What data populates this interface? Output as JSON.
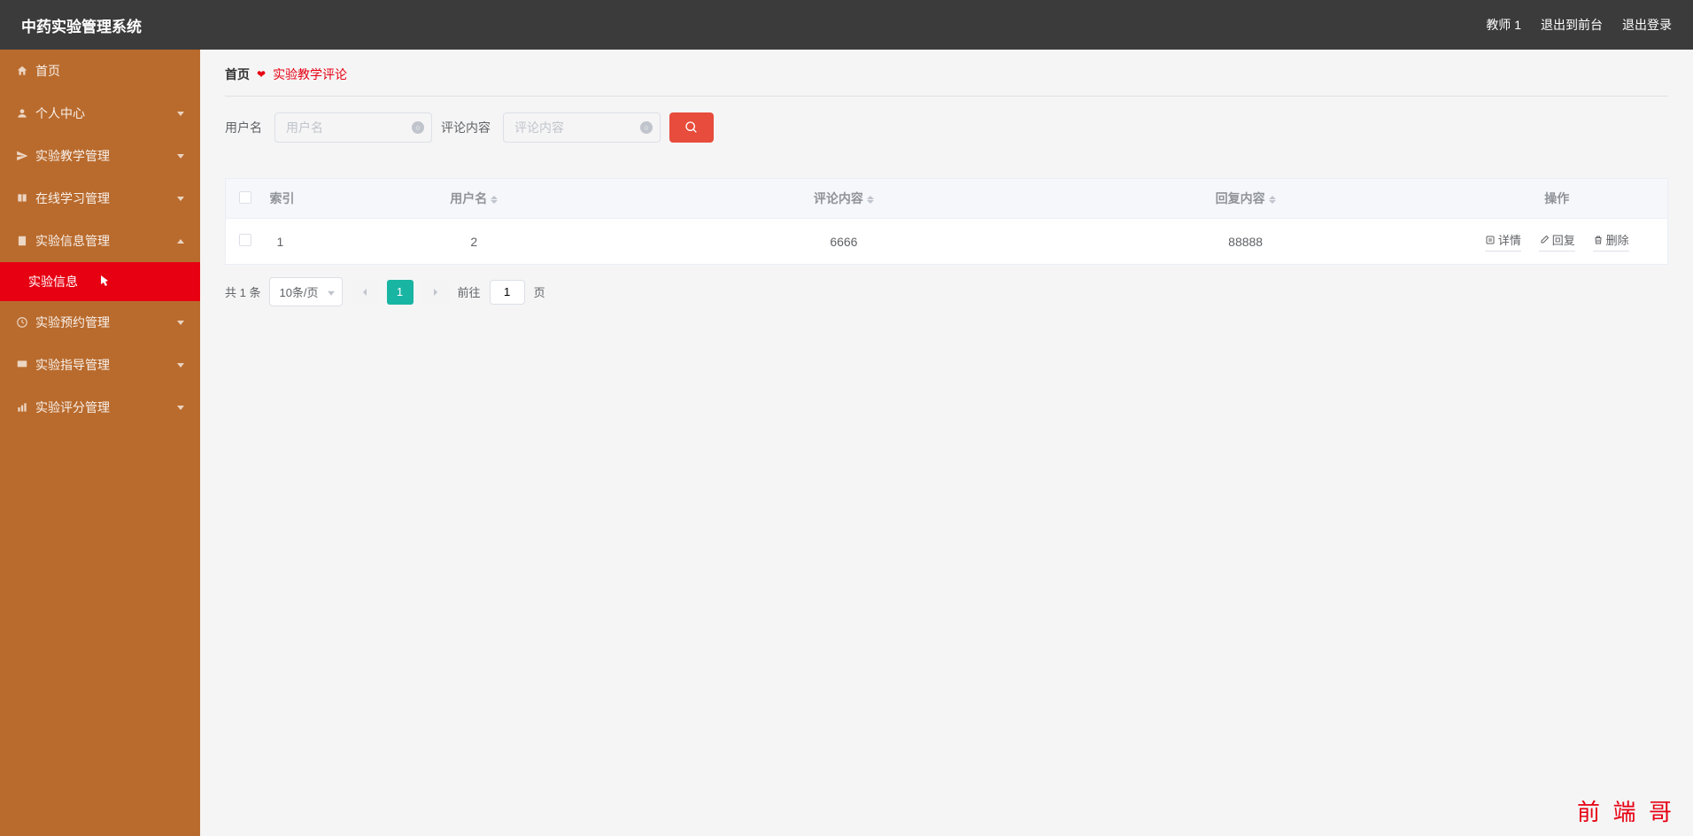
{
  "header": {
    "title": "中药实验管理系统",
    "user": "教师 1",
    "back_to_front": "退出到前台",
    "logout": "退出登录"
  },
  "sidebar": {
    "items": [
      {
        "label": "首页",
        "icon": "home"
      },
      {
        "label": "个人中心",
        "icon": "user",
        "has_children": true,
        "expanded": false
      },
      {
        "label": "实验教学管理",
        "icon": "send",
        "has_children": true,
        "expanded": false
      },
      {
        "label": "在线学习管理",
        "icon": "book",
        "has_children": true,
        "expanded": false
      },
      {
        "label": "实验信息管理",
        "icon": "file",
        "has_children": true,
        "expanded": true
      },
      {
        "label": "实验预约管理",
        "icon": "clock",
        "has_children": true,
        "expanded": false
      },
      {
        "label": "实验指导管理",
        "icon": "monitor",
        "has_children": true,
        "expanded": false
      },
      {
        "label": "实验评分管理",
        "icon": "chart",
        "has_children": true,
        "expanded": false
      }
    ],
    "subitem": "实验信息"
  },
  "breadcrumb": {
    "home": "首页",
    "current": "实验教学评论"
  },
  "search": {
    "username_label": "用户名",
    "username_placeholder": "用户名",
    "content_label": "评论内容",
    "content_placeholder": "评论内容"
  },
  "table": {
    "headers": {
      "index": "索引",
      "username": "用户名",
      "comment": "评论内容",
      "reply": "回复内容",
      "actions": "操作"
    },
    "rows": [
      {
        "index": "1",
        "username": "2",
        "comment": "6666",
        "reply": "88888"
      }
    ],
    "actions": {
      "detail": "详情",
      "reply": "回复",
      "delete": "删除"
    }
  },
  "pagination": {
    "total": "共 1 条",
    "page_size": "10条/页",
    "current_page": "1",
    "goto_prefix": "前往",
    "goto_suffix": "页",
    "goto_value": "1"
  },
  "watermark": "前 端 哥"
}
